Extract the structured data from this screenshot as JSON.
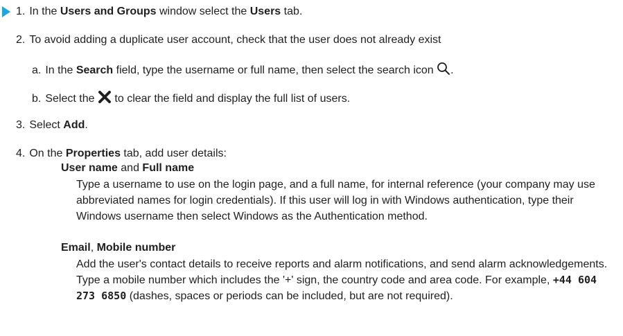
{
  "steps": {
    "s1": {
      "num": "1.",
      "t1": "In the ",
      "b1": "Users and Groups",
      "t2": " window select the ",
      "b2": "Users",
      "t3": " tab."
    },
    "s2": {
      "num": "2.",
      "text": "To avoid adding a duplicate user account, check that the user does not already exist"
    },
    "s2a": {
      "num": "a.",
      "t1": "In the ",
      "b1": "Search",
      "t2": " field, type the username or full name, then select the search icon",
      "t3": "."
    },
    "s2b": {
      "num": "b.",
      "t1": "Select the ",
      "t2": " to clear the field and display the full list of users."
    },
    "s3": {
      "num": "3.",
      "t1": "Select ",
      "b1": "Add",
      "t2": "."
    },
    "s4": {
      "num": "4.",
      "t1": "On the ",
      "b1": "Properties",
      "t2": " tab, add user details:"
    }
  },
  "definitions": {
    "username": {
      "b1": "User name",
      "t1": " and ",
      "b2": "Full name",
      "desc": "Type a username to use on the login page, and a full name, for internal reference (your company may use abbreviated names for login credentials). If this user will log in with Windows authentication, type their Windows username then select Windows as the Authentication method."
    },
    "contact": {
      "b1": "Email",
      "t1": ", ",
      "b2": "Mobile number",
      "desc1": "Add the user's contact details to receive reports and alarm notifications, and send alarm acknowledgements. Type a mobile number which includes the '+' sign, the country code and area code. For example, ",
      "example": "+44 604 273 6850",
      "desc2": " (dashes, spaces or periods can be included, but are not required)."
    }
  },
  "icons": {
    "step_marker": "play-arrow-icon",
    "search": "search-icon",
    "clear": "close-icon"
  },
  "colors": {
    "step_marker": "#1aa8e0",
    "text": "#1f1f1f"
  }
}
